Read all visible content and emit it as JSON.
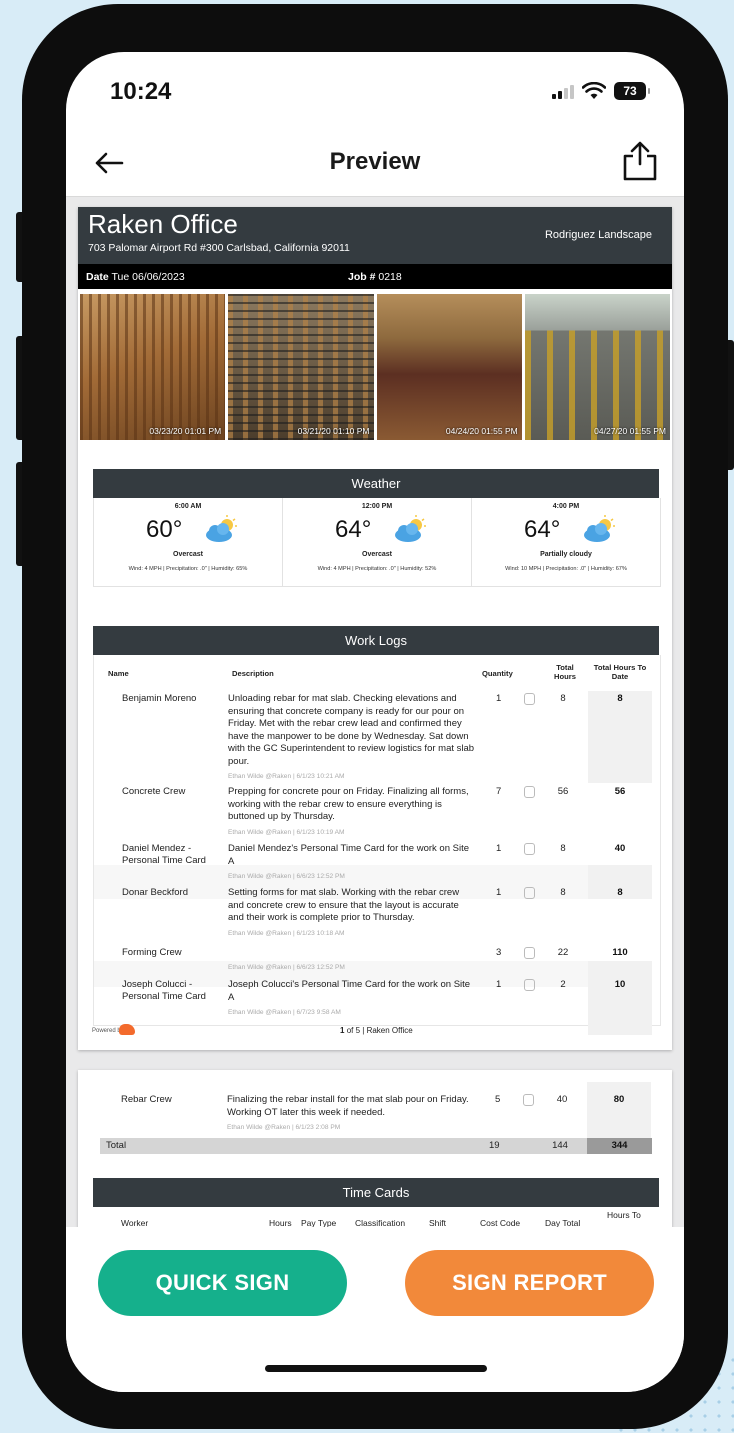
{
  "status_bar": {
    "time": "10:24",
    "battery": "73"
  },
  "nav": {
    "title": "Preview",
    "back_icon": "back-arrow-icon",
    "share_icon": "share-icon"
  },
  "report": {
    "company": "Raken Office",
    "address": "703 Palomar Airport Rd #300 Carlsbad, California 92011",
    "subcontractor": "Rodriguez Landscape",
    "date_label": "Date",
    "date_value": "Tue 06/06/2023",
    "job_label": "Job #",
    "job_value": "0218",
    "photos": [
      {
        "stamp": "03/23/20 01:01 PM"
      },
      {
        "stamp": "03/21/20 01:10 PM"
      },
      {
        "stamp": "04/24/20 01:55 PM"
      },
      {
        "stamp": "04/27/20 01:55 PM"
      }
    ]
  },
  "weather": {
    "title": "Weather",
    "entries": [
      {
        "time": "6:00 AM",
        "temp": "60°",
        "desc": "Overcast",
        "wind": "Wind: 4 MPH",
        "precip": "Precipitation: .0\"",
        "humidity": "Humidity: 65%"
      },
      {
        "time": "12:00 PM",
        "temp": "64°",
        "desc": "Overcast",
        "wind": "Wind: 4 MPH",
        "precip": "Precipitation: .0\"",
        "humidity": "Humidity: 52%"
      },
      {
        "time": "4:00 PM",
        "temp": "64°",
        "desc": "Partially cloudy",
        "wind": "Wind: 10 MPH",
        "precip": "Precipitation: .0\"",
        "humidity": "Humidity: 67%"
      }
    ]
  },
  "work_logs": {
    "title": "Work Logs",
    "headers": {
      "name": "Name",
      "description": "Description",
      "quantity": "Quantity",
      "total_hours": "Total Hours",
      "total_to_date": "Total Hours To Date"
    },
    "rows": [
      {
        "name": "Benjamin Moreno",
        "description": "Unloading rebar for mat slab. Checking elevations and ensuring that concrete company is ready for our pour on Friday. Met with the rebar crew lead and confirmed they have the manpower to be done by Wednesday. Sat down with the GC Superintendent to review logistics for mat slab pour.",
        "meta": "Ethan Wilde @Raken | 6/1/23 10:21 AM",
        "qty": "1",
        "hours": "8",
        "to_date": "8"
      },
      {
        "name": "Concrete Crew",
        "description": "Prepping for concrete pour on Friday. Finalizing all forms, working with the rebar crew to ensure everything is buttoned up by Thursday.",
        "meta": "Ethan Wilde @Raken | 6/1/23 10:19 AM",
        "qty": "7",
        "hours": "56",
        "to_date": "56"
      },
      {
        "name": "Daniel Mendez - Personal Time Card",
        "description": "Daniel Mendez's Personal Time Card for the work on Site A",
        "meta": "Ethan Wilde @Raken | 6/6/23 12:52 PM",
        "qty": "1",
        "hours": "8",
        "to_date": "40"
      },
      {
        "name": "Donar Beckford",
        "description": "Setting forms for mat slab. Working with the rebar crew and concrete crew to ensure that the layout is accurate and their work is complete prior to Thursday.",
        "meta": "Ethan Wilde @Raken | 6/1/23 10:18 AM",
        "qty": "1",
        "hours": "8",
        "to_date": "8"
      },
      {
        "name": "Forming Crew",
        "description": "",
        "meta": "Ethan Wilde @Raken | 6/6/23 12:52 PM",
        "qty": "3",
        "hours": "22",
        "to_date": "110"
      },
      {
        "name": "Joseph Colucci - Personal Time Card",
        "description": "Joseph Colucci's Personal Time Card for the work on Site A",
        "meta": "Ethan Wilde @Raken | 6/7/23 9:58 AM",
        "qty": "1",
        "hours": "2",
        "to_date": "10"
      }
    ],
    "page2_row": {
      "name": "Rebar Crew",
      "description": "Finalizing the rebar install for the mat slab pour on Friday. Working OT later this week if needed.",
      "meta": "Ethan Wilde @Raken | 6/1/23 2:08 PM",
      "qty": "5",
      "hours": "40",
      "to_date": "80"
    },
    "total": {
      "label": "Total",
      "qty": "19",
      "hours": "144",
      "to_date": "344"
    }
  },
  "footer": {
    "powered_by": "Powered by",
    "page_current": "1",
    "page_text": "of 5",
    "page_org": "| Raken Office"
  },
  "time_cards": {
    "title": "Time Cards",
    "headers": [
      "Worker",
      "Hours",
      "Pay Type",
      "Classification",
      "Shift",
      "Cost Code",
      "Day Total",
      "Hours To"
    ]
  },
  "actions": {
    "quick_sign": "QUICK SIGN",
    "sign_report": "SIGN REPORT"
  },
  "colors": {
    "quick_sign": "#15b08c",
    "sign_report": "#f2893a",
    "header_bar": "#343b40"
  }
}
